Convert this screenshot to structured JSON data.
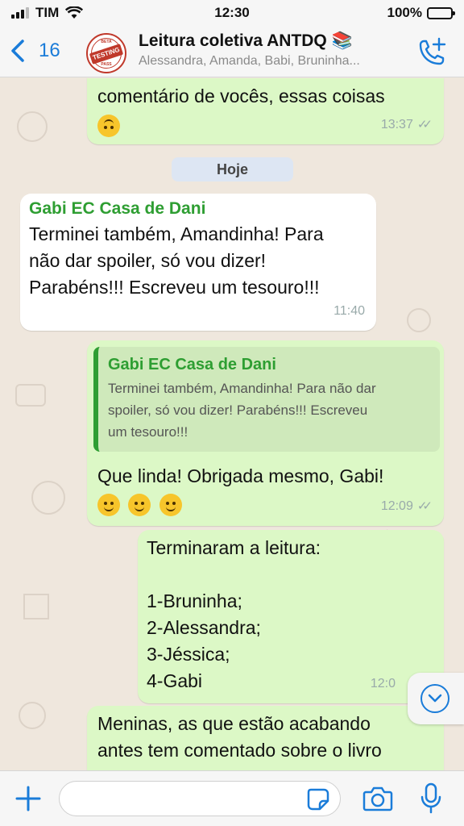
{
  "status_bar": {
    "carrier": "TIM",
    "time": "12:30",
    "battery": "100%"
  },
  "header": {
    "back_count": "16",
    "avatar_text": {
      "top": "BETA",
      "middle": "TESTING",
      "bottom": "PASS"
    },
    "group_title": "Leitura coletiva ANTDQ 📚",
    "members": "Alessandra, Amanda, Babi, Bruninha..."
  },
  "messages": {
    "m1": {
      "text": "comentário de vocês, essas coisas",
      "time": "13:37"
    },
    "date_divider": "Hoje",
    "m2": {
      "sender": "Gabi EC Casa de Dani",
      "lines": [
        "Terminei também, Amandinha! Para",
        "não dar spoiler, só vou dizer!",
        "Parabéns!!! Escreveu um tesouro!!!"
      ],
      "time": "11:40"
    },
    "m3": {
      "quote_sender": "Gabi EC Casa de Dani",
      "quote_lines": [
        "Terminei também, Amandinha! Para não dar",
        "spoiler, só vou dizer! Parabéns!!! Escreveu",
        "um tesouro!!!"
      ],
      "text": "Que linda! Obrigada mesmo, Gabi!",
      "time": "12:09"
    },
    "m4": {
      "lines": [
        "Terminaram a leitura:",
        "",
        "1-Bruninha;",
        "2-Alessandra;",
        "3-Jéssica;",
        "4-Gabi"
      ],
      "time": "12:0"
    },
    "m5": {
      "lines": [
        "Meninas, as que estão acabando",
        "antes tem comentado sobre o livro"
      ]
    }
  },
  "colors": {
    "accent": "#1a7cd9",
    "outgoing": "#dcf8c6",
    "incoming": "#ffffff",
    "sender": "#2e9e32"
  },
  "icons": [
    "back-chevron-icon",
    "add-call-icon",
    "scroll-down-icon",
    "plus-icon",
    "sticker-icon",
    "camera-icon",
    "mic-icon"
  ]
}
